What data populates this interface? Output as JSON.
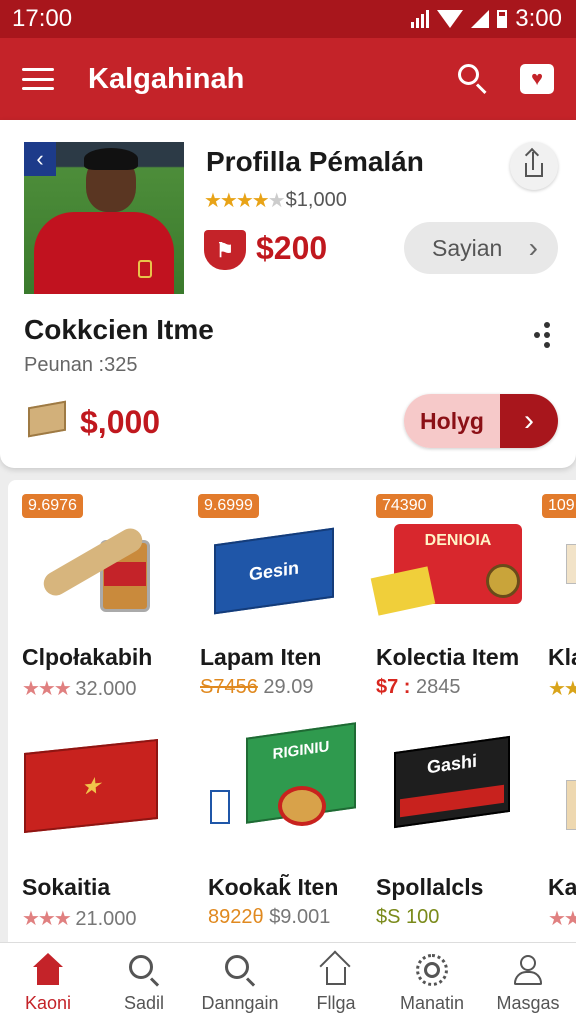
{
  "status": {
    "time": "17:00",
    "right_time": "3:00"
  },
  "app_bar": {
    "title": "Kalgahinah"
  },
  "profile": {
    "title": "Profilla Pémalán",
    "rating_price": "$1,000",
    "rating_stars": 4,
    "price": "$200",
    "action_label": "Sayian"
  },
  "collection": {
    "title": "Cokkcien Itme",
    "subtitle": "Peunan :325",
    "price": "$,000",
    "action_label": "Holyg"
  },
  "products": [
    {
      "badge": "9.6976",
      "name": "Clpołakabih",
      "stars": 3,
      "meta": "32.000"
    },
    {
      "badge": "9.6999",
      "name": "Lapam Iten",
      "meta_prefix": "S7456",
      "meta": "29.09"
    },
    {
      "badge": "74390",
      "name": "Kolectia Item",
      "meta_prefix": "$7 :",
      "meta": "2845"
    },
    {
      "badge": "109",
      "name": "Kla",
      "stars": 2
    },
    {
      "name": "Sokaitia",
      "stars": 3,
      "meta": "21.000"
    },
    {
      "name": "Kookak̃ Iten",
      "meta_prefix": "8922θ",
      "meta": "$9.001"
    },
    {
      "name": "Spollalcls",
      "meta_prefix": "$S 100"
    },
    {
      "name": "Ka",
      "stars": 2
    }
  ],
  "product_images": {
    "p2": "Gesin",
    "p3": "DENIOIA",
    "p6": "RIGINIU",
    "p7": "Gashi"
  },
  "nav": [
    {
      "label": "Kaoni",
      "icon": "home-icon",
      "active": true
    },
    {
      "label": "Sadil",
      "icon": "search-icon"
    },
    {
      "label": "Danngain",
      "icon": "search-icon"
    },
    {
      "label": "Fllga",
      "icon": "house-outline-icon"
    },
    {
      "label": "Manatin",
      "icon": "settings-icon"
    },
    {
      "label": "Masgas",
      "icon": "profile-icon"
    }
  ],
  "colors": {
    "primary": "#c42329",
    "status_bar": "#a8161c",
    "price_red": "#c0181e",
    "badge_orange": "#e27b2c"
  }
}
